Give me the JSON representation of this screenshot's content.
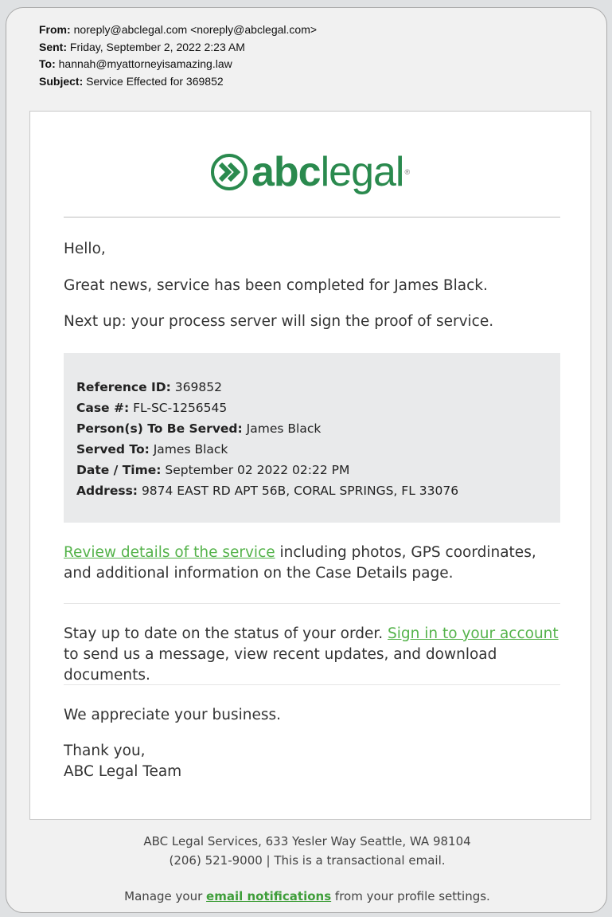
{
  "email_headers": {
    "from_label": "From:",
    "from_value": "noreply@abclegal.com <noreply@abclegal.com>",
    "sent_label": "Sent:",
    "sent_value": "Friday, September 2, 2022 2:23 AM",
    "to_label": "To:",
    "to_value": "hannah@myattorneyisamazing.law",
    "subject_label": "Subject:",
    "subject_value": "Service Effected for 369852"
  },
  "logo": {
    "word_abc": "abc",
    "word_legal": "legal",
    "registered": "®",
    "brand_color": "#2a8a4e"
  },
  "body": {
    "greeting": "Hello,",
    "line1": "Great news, service has been completed for James Black.",
    "line2": "Next up: your process server will sign the proof of service."
  },
  "details": [
    {
      "label": "Reference ID:",
      "value": "369852"
    },
    {
      "label": "Case #:",
      "value": "FL-SC-1256545"
    },
    {
      "label": "Person(s) To Be Served:",
      "value": "James Black"
    },
    {
      "label": "Served To:",
      "value": "James Black"
    },
    {
      "label": "Date / Time:",
      "value": "September 02 2022 02:22 PM"
    },
    {
      "label": "Address:",
      "value": "9874 EAST RD APT 56B, CORAL SPRINGS, FL 33076"
    }
  ],
  "review": {
    "link_text": "Review details of the service",
    "rest": "including photos, GPS coordinates, and additional information on the Case Details page."
  },
  "status": {
    "before": "Stay up to date on the status of your order.",
    "link_text": "Sign in to your account",
    "after": "to send us a message, view recent updates, and download documents."
  },
  "closing": {
    "appreciate": "We appreciate your business.",
    "thanks": "Thank you,",
    "team": "ABC Legal Team"
  },
  "footer": {
    "address": "ABC Legal Services, 633 Yesler Way Seattle, WA 98104",
    "phone_line": "(206) 521-9000 | This is a transactional email.",
    "manage_before": "Manage your",
    "manage_link": "email notifications",
    "manage_after": "from your profile settings."
  },
  "colors": {
    "link": "#55b34b",
    "panel_bg": "#e9eaeb"
  }
}
